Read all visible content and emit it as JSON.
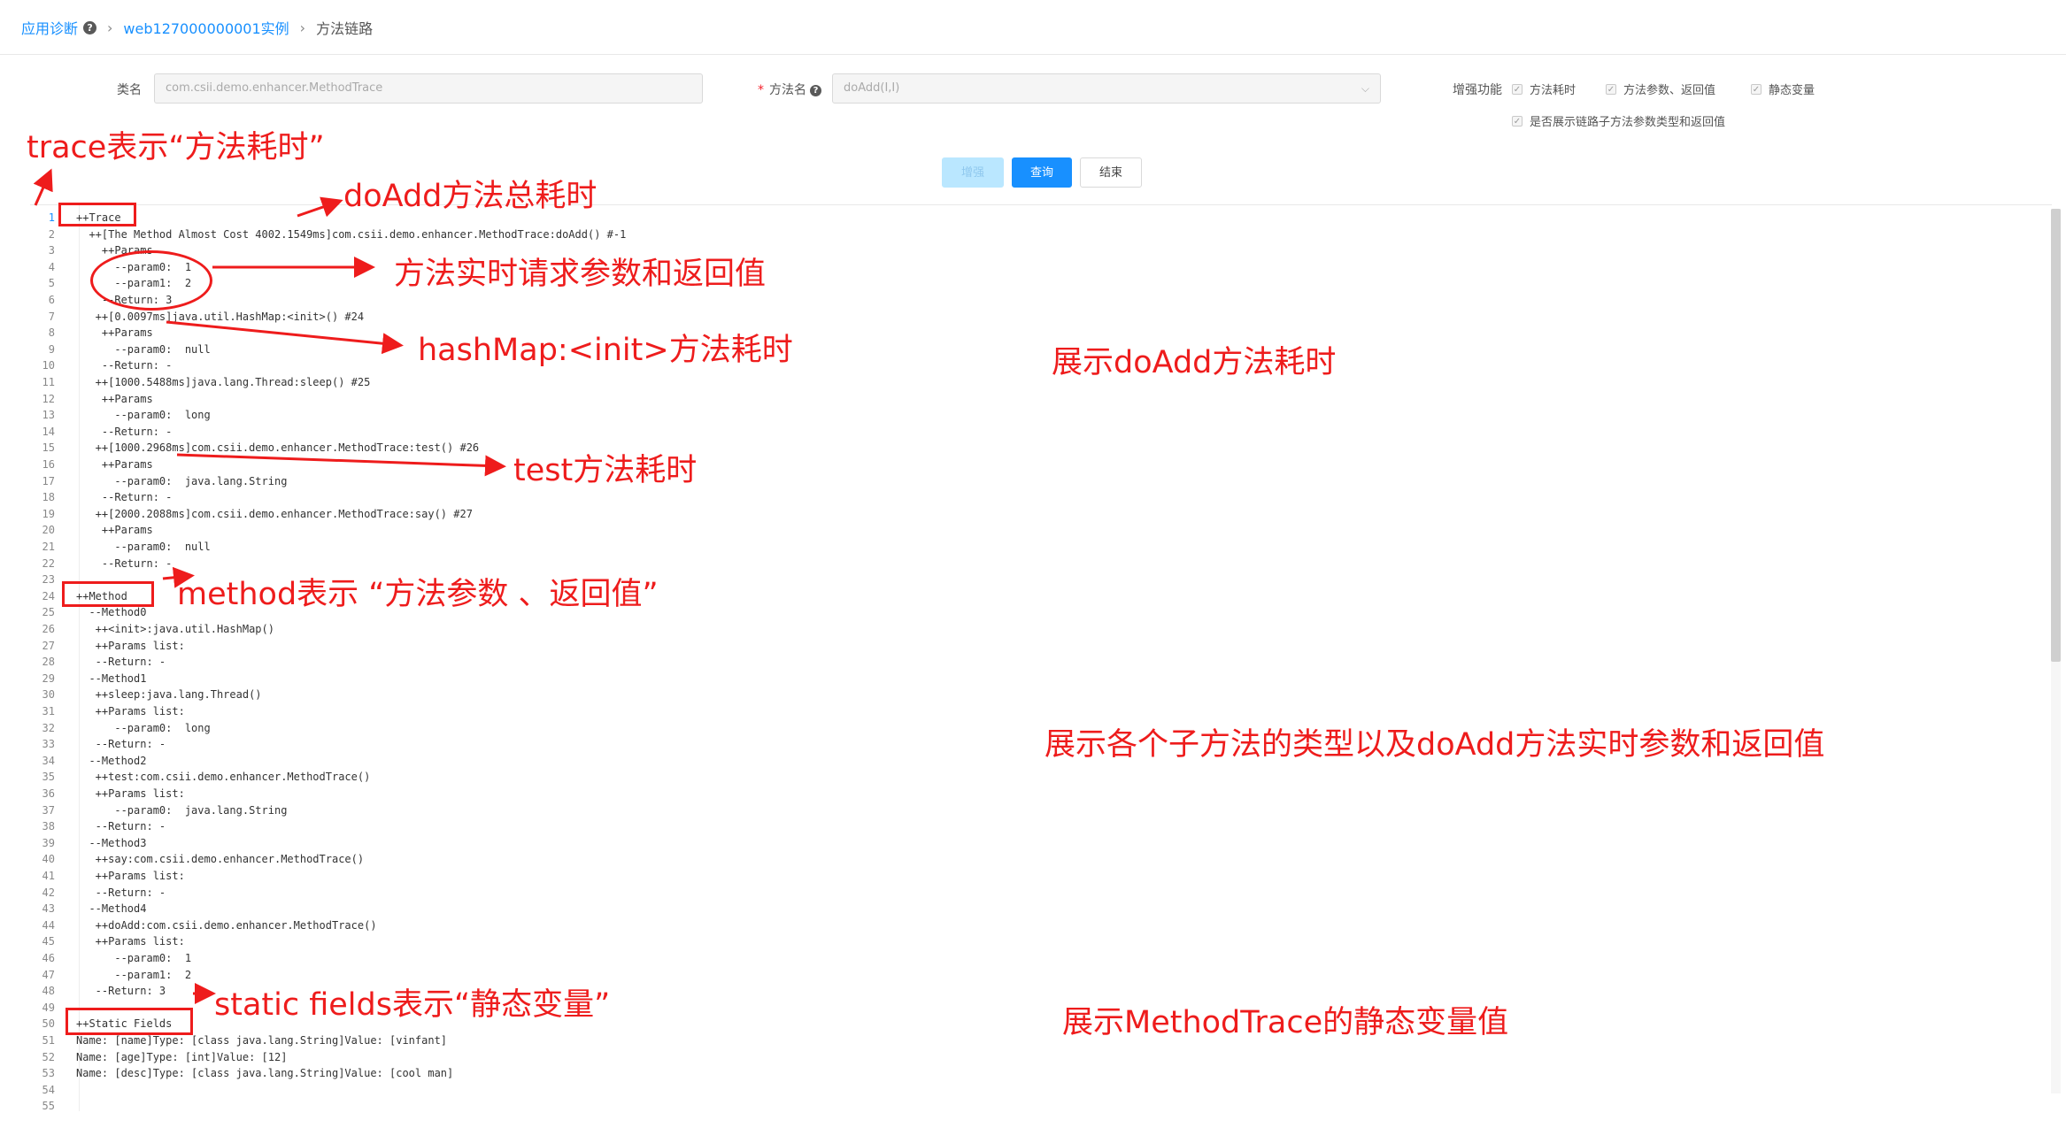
{
  "breadcrumb": {
    "root": "应用诊断",
    "instance": "web127000000001实例",
    "current": "方法链路"
  },
  "form": {
    "class_label": "类名",
    "class_value": "com.csii.demo.enhancer.MethodTrace",
    "method_label": "方法名",
    "method_value": "doAdd(I,I)",
    "enhance_label": "增强功能",
    "options": [
      "方法耗时",
      "方法参数、返回值",
      "静态变量"
    ],
    "show_child_types": "是否展示链路子方法参数类型和返回值"
  },
  "buttons": {
    "enhance": "增强",
    "query": "查询",
    "end": "结束"
  },
  "code_lines": [
    "++Trace",
    "  ++[The Method Almost Cost 4002.1549ms]com.csii.demo.enhancer.MethodTrace:doAdd() #-1",
    "    ++Params",
    "      --param0:  1",
    "      --param1:  2",
    "    --Return: 3",
    "   ++[0.0097ms]java.util.HashMap:<init>() #24",
    "    ++Params",
    "      --param0:  null",
    "    --Return: -",
    "   ++[1000.5488ms]java.lang.Thread:sleep() #25",
    "    ++Params",
    "      --param0:  long",
    "    --Return: -",
    "   ++[1000.2968ms]com.csii.demo.enhancer.MethodTrace:test() #26",
    "    ++Params",
    "      --param0:  java.lang.String",
    "    --Return: -",
    "   ++[2000.2088ms]com.csii.demo.enhancer.MethodTrace:say() #27",
    "    ++Params",
    "      --param0:  null",
    "    --Return: -",
    "",
    "++Method",
    "  --Method0",
    "   ++<init>:java.util.HashMap()",
    "   ++Params list:",
    "   --Return: -",
    "  --Method1",
    "   ++sleep:java.lang.Thread()",
    "   ++Params list:",
    "      --param0:  long",
    "   --Return: -",
    "  --Method2",
    "   ++test:com.csii.demo.enhancer.MethodTrace()",
    "   ++Params list:",
    "      --param0:  java.lang.String",
    "   --Return: -",
    "  --Method3",
    "   ++say:com.csii.demo.enhancer.MethodTrace()",
    "   ++Params list:",
    "   --Return: -",
    "  --Method4",
    "   ++doAdd:com.csii.demo.enhancer.MethodTrace()",
    "   ++Params list:",
    "      --param0:  1",
    "      --param1:  2",
    "   --Return: 3",
    "",
    "++Static Fields",
    "Name: [name]Type: [class java.lang.String]Value: [vinfant]",
    "Name: [age]Type: [int]Value: [12]",
    "Name: [desc]Type: [class java.lang.String]Value: [cool man]",
    "",
    ""
  ],
  "annotations": {
    "trace": "trace表示“方法耗时”",
    "doadd_total": "doAdd方法总耗时",
    "realtime_params": "方法实时请求参数和返回值",
    "hashmap_init": "hashMap:<init>方法耗时",
    "show_doadd": "展示doAdd方法耗时",
    "test_cost": "test方法耗时",
    "method_desc": "method表示 “方法参数 、返回值”",
    "show_child": "展示各个子方法的类型以及doAdd方法实时参数和返回值",
    "static_desc": "static fields表示“静态变量”",
    "show_static": "展示MethodTrace的静态变量值"
  },
  "colors": {
    "accent": "#1890ff",
    "annotation": "#ee1c1c"
  }
}
